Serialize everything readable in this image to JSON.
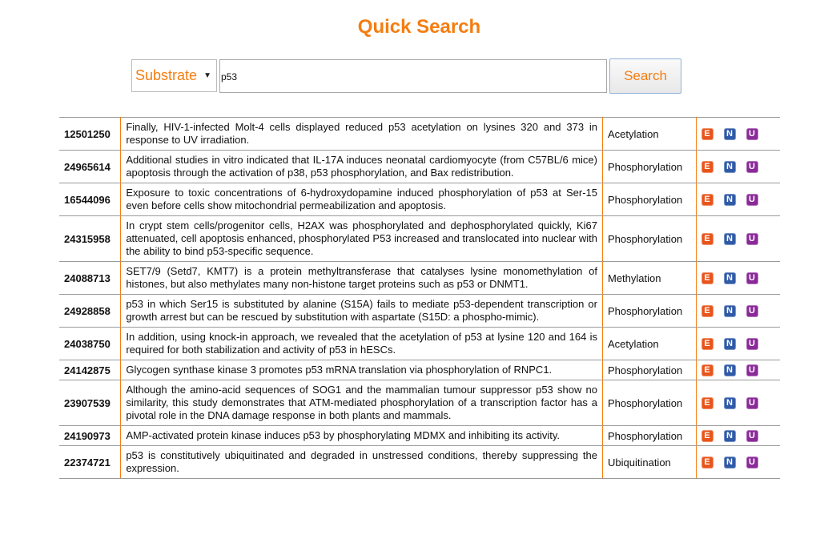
{
  "page": {
    "title": "Quick Search"
  },
  "search": {
    "type_selected": "Substrate",
    "query": "p53",
    "button_label": "Search"
  },
  "links": {
    "e": "E",
    "n": "N",
    "u": "U"
  },
  "colors": {
    "accent": "#f57d10",
    "badge_e": "#e8541b",
    "badge_n": "#2f5aa8",
    "badge_u": "#8a2a98"
  },
  "results": [
    {
      "pmid": "12501250",
      "sentence": "Finally, HIV-1-infected Molt-4 cells displayed reduced p53 acetylation on lysines 320 and 373 in response to UV irradiation.",
      "ptm": "Acetylation"
    },
    {
      "pmid": "24965614",
      "sentence": "Additional studies in vitro indicated that IL-17A induces neonatal cardiomyocyte (from C57BL/6 mice) apoptosis through the activation of p38, p53 phosphorylation, and Bax redistribution.",
      "ptm": "Phosphorylation"
    },
    {
      "pmid": "16544096",
      "sentence": "Exposure to toxic concentrations of 6-hydroxydopamine induced phosphorylation of p53 at Ser-15 even before cells show mitochondrial permeabilization and apoptosis.",
      "ptm": "Phosphorylation"
    },
    {
      "pmid": "24315958",
      "sentence": "In crypt stem cells/progenitor cells, H2AX was phosphorylated and dephosphorylated quickly, Ki67 attenuated, cell apoptosis enhanced, phosphorylated P53 increased and translocated into nuclear with the ability to bind p53-specific sequence.",
      "ptm": "Phosphorylation"
    },
    {
      "pmid": "24088713",
      "sentence": "SET7/9 (Setd7, KMT7) is a protein methyltransferase that catalyses lysine monomethylation of histones, but also methylates many non-histone target proteins such as p53 or DNMT1.",
      "ptm": "Methylation"
    },
    {
      "pmid": "24928858",
      "sentence": "p53 in which Ser15 is substituted by alanine (S15A) fails to mediate p53-dependent transcription or growth arrest but can be rescued by substitution with aspartate (S15D: a phospho-mimic).",
      "ptm": "Phosphorylation"
    },
    {
      "pmid": "24038750",
      "sentence": "In addition, using knock-in approach, we revealed that the acetylation of p53 at lysine 120 and 164 is required for both stabilization and activity of p53 in hESCs.",
      "ptm": "Acetylation"
    },
    {
      "pmid": "24142875",
      "sentence": "Glycogen synthase kinase 3 promotes p53 mRNA translation via phosphorylation of RNPC1.",
      "ptm": "Phosphorylation"
    },
    {
      "pmid": "23907539",
      "sentence": "Although the amino-acid sequences of SOG1 and the mammalian tumour suppressor p53 show no similarity, this study demonstrates that ATM-mediated phosphorylation of a transcription factor has a pivotal role in the DNA damage response in both plants and mammals.",
      "ptm": "Phosphorylation"
    },
    {
      "pmid": "24190973",
      "sentence": "AMP-activated protein kinase induces p53 by phosphorylating MDMX and inhibiting its activity.",
      "ptm": "Phosphorylation"
    },
    {
      "pmid": "22374721",
      "sentence": "p53 is constitutively ubiquitinated and degraded in unstressed conditions, thereby suppressing the expression.",
      "ptm": "Ubiquitination"
    }
  ]
}
